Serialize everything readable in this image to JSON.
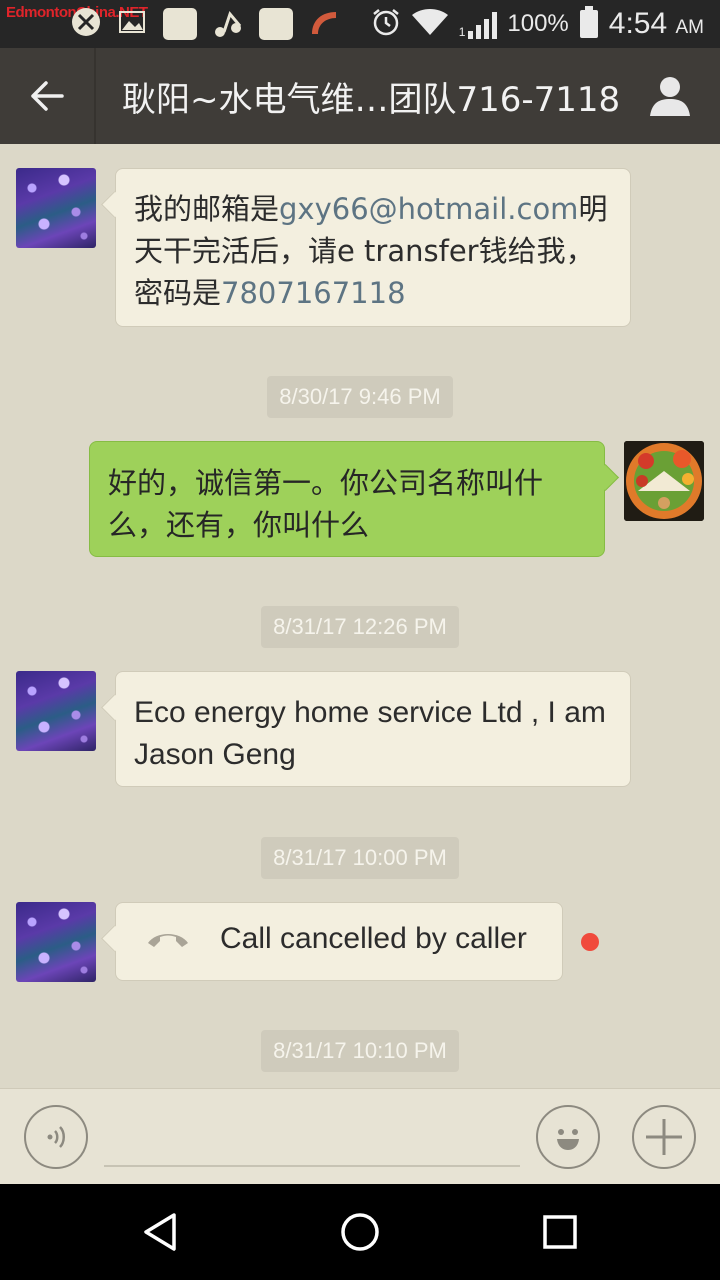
{
  "status_bar": {
    "watermark": "EdmontonChina.NET",
    "battery": "100%",
    "time": "4:54",
    "ampm": "AM",
    "signal_label": "1"
  },
  "header": {
    "title": "耿阳~水电气维…团队716-7118"
  },
  "messages": [
    {
      "type": "incoming_text",
      "text_pre": "我的邮箱是",
      "email": "gxy66@hotmail.com",
      "text_mid": "明天干完活后，请e transfer钱给我，密码是",
      "password": "7807167118"
    },
    {
      "type": "timestamp",
      "text": "8/30/17 9:46 PM"
    },
    {
      "type": "outgoing_text",
      "text": "好的，诚信第一。你公司名称叫什么，还有，你叫什么"
    },
    {
      "type": "timestamp",
      "text": "8/31/17 12:26 PM"
    },
    {
      "type": "incoming_text",
      "text": "Eco energy home service Ltd , I am Jason Geng"
    },
    {
      "type": "timestamp",
      "text": "8/31/17 10:00 PM"
    },
    {
      "type": "incoming_call",
      "text": "Call cancelled by caller"
    },
    {
      "type": "timestamp",
      "text": "8/31/17 10:10 PM"
    }
  ],
  "colors": {
    "outgoing_bubble": "#9ed15a",
    "incoming_bubble": "#f3efdf",
    "unread_dot": "#f04a3c",
    "header": "#3f3c38"
  },
  "icons": [
    "back-arrow-icon",
    "profile-icon",
    "voice-icon",
    "emoji-icon",
    "plus-icon",
    "call-icon"
  ]
}
